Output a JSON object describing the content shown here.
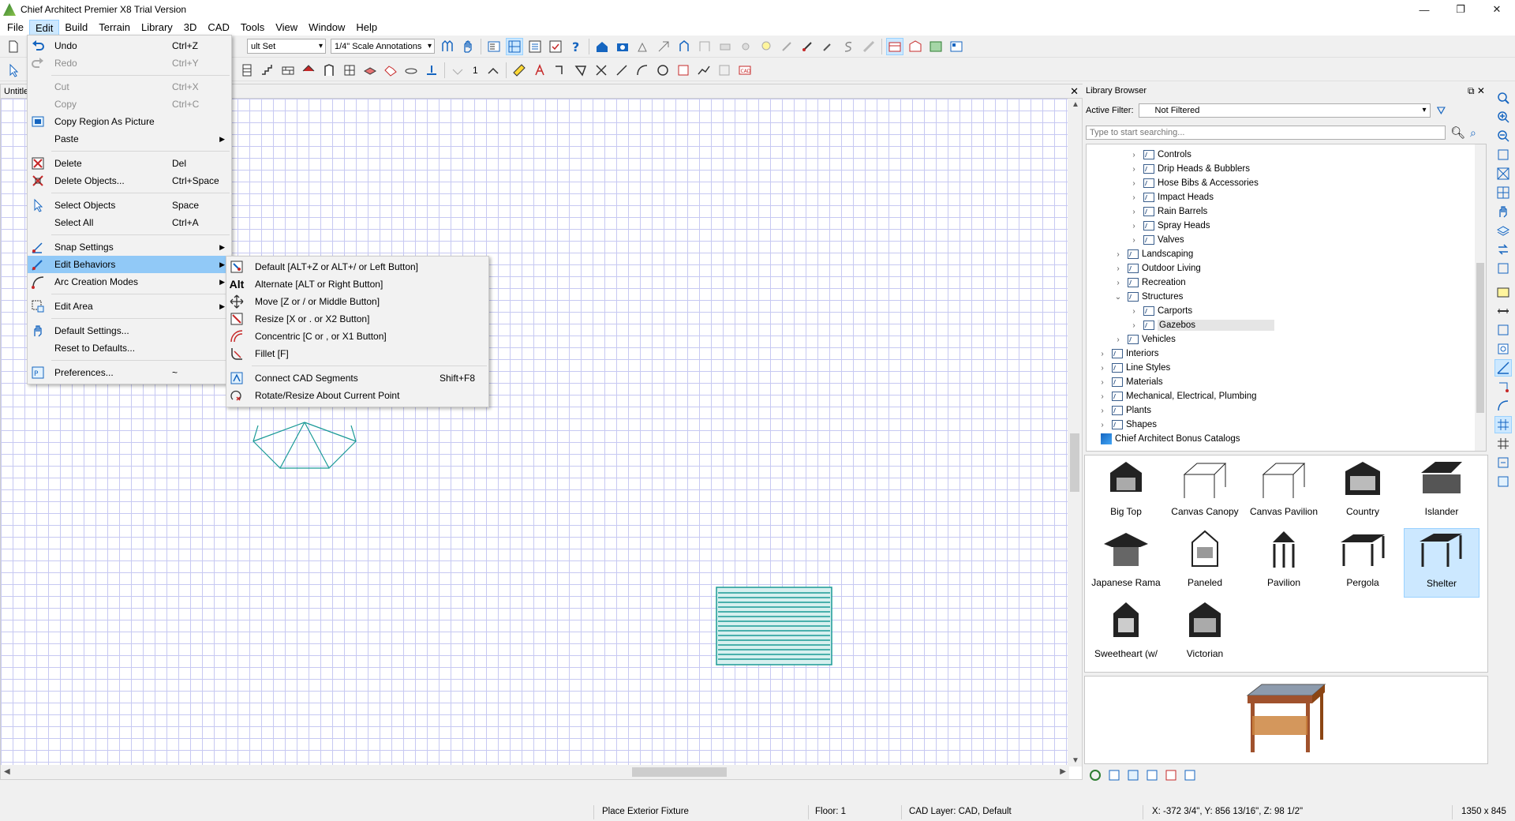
{
  "window": {
    "title": "Chief Architect Premier X8 Trial Version"
  },
  "menubar": [
    "File",
    "Edit",
    "Build",
    "Terrain",
    "Library",
    "3D",
    "CAD",
    "Tools",
    "View",
    "Window",
    "Help"
  ],
  "toolbar": {
    "layer_set": "ult Set",
    "annotation_set": "1/4\" Scale Annotations",
    "step_value": "1"
  },
  "document": {
    "tab_title": "Untitle"
  },
  "edit_menu": {
    "items": [
      {
        "label": "Undo",
        "shortcut": "Ctrl+Z"
      },
      {
        "label": "Redo",
        "shortcut": "Ctrl+Y"
      },
      {
        "label": "Cut",
        "shortcut": "Ctrl+X"
      },
      {
        "label": "Copy",
        "shortcut": "Ctrl+C"
      },
      {
        "label": "Copy Region As Picture",
        "shortcut": ""
      },
      {
        "label": "Paste",
        "shortcut": ""
      },
      {
        "label": "Delete",
        "shortcut": "Del"
      },
      {
        "label": "Delete Objects...",
        "shortcut": "Ctrl+Space"
      },
      {
        "label": "Select Objects",
        "shortcut": "Space"
      },
      {
        "label": "Select All",
        "shortcut": "Ctrl+A"
      },
      {
        "label": "Snap Settings",
        "shortcut": ""
      },
      {
        "label": "Edit Behaviors",
        "shortcut": ""
      },
      {
        "label": "Arc Creation Modes",
        "shortcut": ""
      },
      {
        "label": "Edit Area",
        "shortcut": ""
      },
      {
        "label": "Default Settings...",
        "shortcut": ""
      },
      {
        "label": "Reset to Defaults...",
        "shortcut": ""
      },
      {
        "label": "Preferences...",
        "shortcut": "~"
      }
    ]
  },
  "behaviors_menu": {
    "items": [
      {
        "label": "Default [ALT+Z or ALT+/ or Left Button]",
        "shortcut": ""
      },
      {
        "label": "Alternate [ALT or Right Button]",
        "shortcut": ""
      },
      {
        "label": "Move [Z or / or Middle Button]",
        "shortcut": ""
      },
      {
        "label": "Resize [X or . or X2 Button]",
        "shortcut": ""
      },
      {
        "label": "Concentric [C or , or X1 Button]",
        "shortcut": ""
      },
      {
        "label": "Fillet [F]",
        "shortcut": ""
      },
      {
        "label": "Connect CAD Segments",
        "shortcut": "Shift+F8"
      },
      {
        "label": "Rotate/Resize About Current Point",
        "shortcut": ""
      }
    ],
    "alt_glyph": "Alt"
  },
  "library": {
    "title": "Library Browser",
    "filter_label": "Active Filter:",
    "filter_value": "Not Filtered",
    "search_placeholder": "Type to start searching...",
    "tree": [
      "Controls",
      "Drip Heads & Bubblers",
      "Hose Bibs & Accessories",
      "Impact Heads",
      "Rain Barrels",
      "Spray Heads",
      "Valves",
      "Landscaping",
      "Outdoor Living",
      "Recreation",
      "Structures",
      "Carports",
      "Gazebos",
      "Vehicles",
      "Interiors",
      "Line Styles",
      "Materials",
      "Mechanical, Electrical, Plumbing",
      "Plants",
      "Shapes",
      "Chief Architect Bonus Catalogs"
    ],
    "thumbnails": [
      "Big Top",
      "Canvas Canopy",
      "Canvas Pavilion",
      "Country",
      "Islander",
      "Japanese Rama",
      "Paneled",
      "Pavilion",
      "Pergola",
      "Shelter",
      "Sweetheart (w/",
      "Victorian"
    ]
  },
  "status": {
    "action": "Place Exterior Fixture",
    "floor": "Floor: 1",
    "layer": "CAD Layer: CAD,  Default",
    "coords": "X: -372 3/4\", Y: 856 13/16\", Z: 98 1/2\"",
    "size": "1350 x 845"
  },
  "colors": {
    "accent_highlight": "#91c9f7",
    "grid_line": "#c7c9f2",
    "cad_teal": "#1a9a96"
  }
}
